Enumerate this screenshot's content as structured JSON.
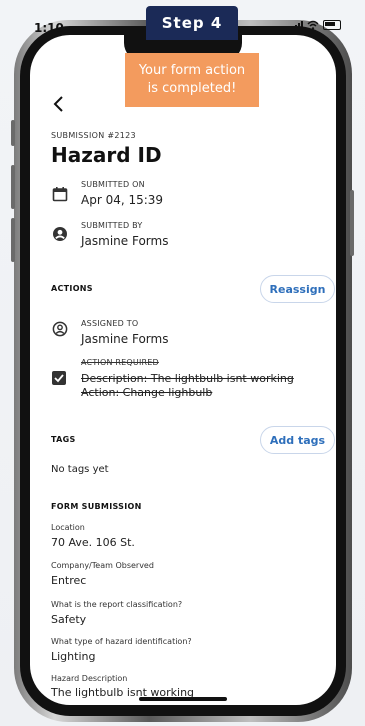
{
  "step": {
    "label": "Step 4"
  },
  "status_bar": {
    "time": "1:10"
  },
  "toast": {
    "line1": "Your form action",
    "line2": "is completed!"
  },
  "header": {
    "back_icon": "chevron-left-icon",
    "submission_number": "SUBMISSION #2123",
    "title": "Hazard ID"
  },
  "submitted_on": {
    "label": "SUBMITTED ON",
    "value": "Apr 04, 15:39"
  },
  "submitted_by": {
    "label": "SUBMITTED BY",
    "value": "Jasmine Forms"
  },
  "actions": {
    "title": "ACTIONS",
    "reassign_label": "Reassign",
    "assigned_to": {
      "label": "ASSIGNED TO",
      "value": "Jasmine Forms"
    },
    "action_required": {
      "label": "ACTION REQUIRED",
      "description": "Description: The lightbulb isnt working",
      "action": "Action: Change lighbulb"
    }
  },
  "tags": {
    "title": "TAGS",
    "add_label": "Add tags",
    "empty_text": "No tags yet"
  },
  "form_submission": {
    "title": "FORM SUBMISSION",
    "fields": [
      {
        "label": "Location",
        "value": "70 Ave. 106 St."
      },
      {
        "label": "Company/Team Observed",
        "value": "Entrec"
      },
      {
        "label": "What is the report classification?",
        "value": "Safety"
      },
      {
        "label": "What type of hazard identification?",
        "value": "Lighting"
      },
      {
        "label": "Hazard Description",
        "value": "The lightbulb isnt working"
      }
    ]
  },
  "colors": {
    "accent": "#2e6fbb",
    "toast": "#f39b5e",
    "step_badge": "#1b2a57"
  }
}
